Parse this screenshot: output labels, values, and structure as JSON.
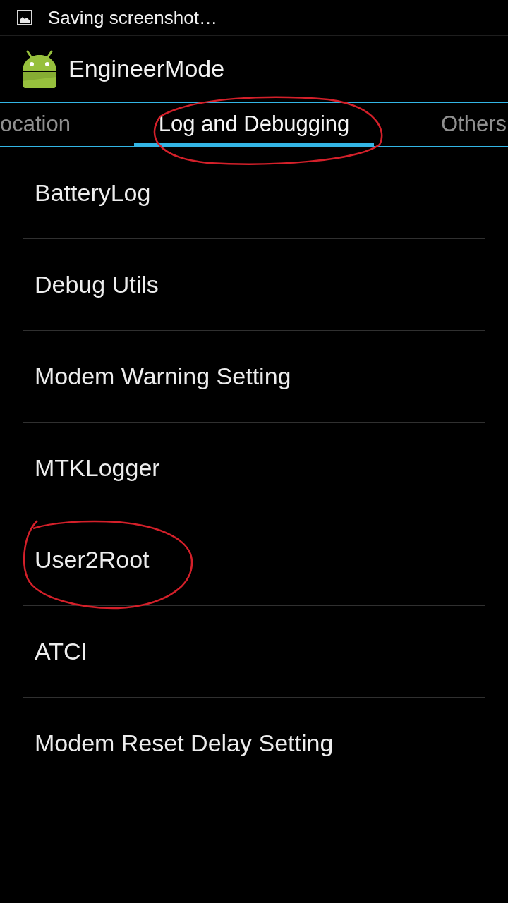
{
  "status_bar": {
    "notification": "Saving screenshot…"
  },
  "action_bar": {
    "title": "EngineerMode"
  },
  "tabs": [
    {
      "label": "ocation",
      "selected": false,
      "circled": false
    },
    {
      "label": "Log and Debugging",
      "selected": true,
      "circled": true
    },
    {
      "label": "Others",
      "selected": false,
      "circled": false
    }
  ],
  "items": [
    {
      "label": "BatteryLog",
      "circled": false
    },
    {
      "label": "Debug Utils",
      "circled": false
    },
    {
      "label": "Modem Warning Setting",
      "circled": false
    },
    {
      "label": "MTKLogger",
      "circled": false
    },
    {
      "label": "User2Root",
      "circled": true
    },
    {
      "label": "ATCI",
      "circled": false
    },
    {
      "label": "Modem Reset Delay Setting",
      "circled": false
    }
  ]
}
